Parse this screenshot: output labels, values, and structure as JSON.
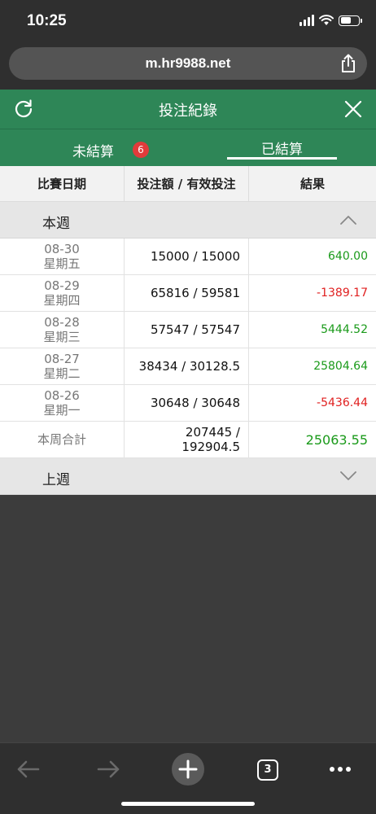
{
  "status": {
    "time": "10:25"
  },
  "browser": {
    "url": "m.hr9988.net",
    "tab_count": "3"
  },
  "header": {
    "title": "投注紀錄"
  },
  "tabs": {
    "unsettled_label": "未結算",
    "unsettled_badge": "6",
    "settled_label": "已結算"
  },
  "table": {
    "columns": [
      "比賽日期",
      "投注額 / 有效投注",
      "結果"
    ],
    "this_week_label": "本週",
    "last_week_label": "上週",
    "rows": [
      {
        "date": "08-30",
        "weekday": "星期五",
        "bet": "15000 / 15000",
        "result": "640.00",
        "sign": "pos"
      },
      {
        "date": "08-29",
        "weekday": "星期四",
        "bet": "65816 / 59581",
        "result": "-1389.17",
        "sign": "neg"
      },
      {
        "date": "08-28",
        "weekday": "星期三",
        "bet": "57547 / 57547",
        "result": "5444.52",
        "sign": "pos"
      },
      {
        "date": "08-27",
        "weekday": "星期二",
        "bet": "38434 / 30128.5",
        "result": "25804.64",
        "sign": "pos"
      },
      {
        "date": "08-26",
        "weekday": "星期一",
        "bet": "30648 / 30648",
        "result": "-5436.44",
        "sign": "neg"
      }
    ],
    "total": {
      "label": "本周合計",
      "bet_line1": "207445 /",
      "bet_line2": "192904.5",
      "result": "25063.55"
    }
  },
  "colors": {
    "header_green": "#2e8657",
    "positive": "#1a9a1a",
    "negative": "#e02020",
    "badge_red": "#e23b3b"
  },
  "icons": {
    "refresh": "refresh-icon",
    "close": "close-icon",
    "share": "share-icon",
    "back": "back-arrow-icon",
    "forward": "forward-arrow-icon",
    "new_tab": "plus-icon",
    "tabs": "tabs-icon",
    "more": "more-icon"
  }
}
